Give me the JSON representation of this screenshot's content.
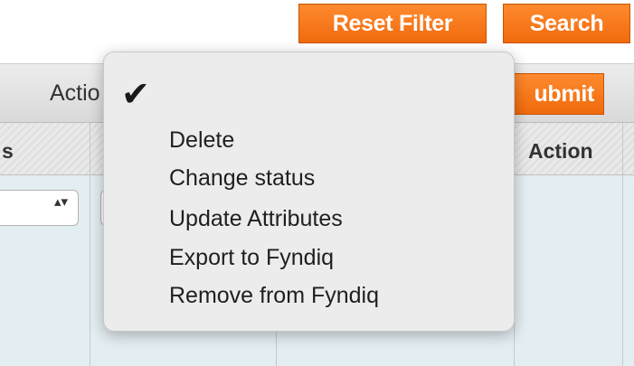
{
  "toolbar": {
    "reset_filter_label": "Reset Filter",
    "search_label": "Search"
  },
  "massaction": {
    "actions_label": "Actio",
    "submit_label": "ubmit"
  },
  "grid": {
    "headers": [
      "s",
      "Action"
    ]
  },
  "dropdown": {
    "selected_marker": "✔",
    "items": [
      "Delete",
      "Change status",
      "Update Attributes",
      "Export to Fyndiq",
      "Remove from Fyndiq"
    ]
  },
  "filter": {
    "select_arrows": "▴▾"
  },
  "colors": {
    "accent_orange": "#f57d1f",
    "popup_background": "#ececec",
    "filter_row_background": "#e3eef2"
  }
}
